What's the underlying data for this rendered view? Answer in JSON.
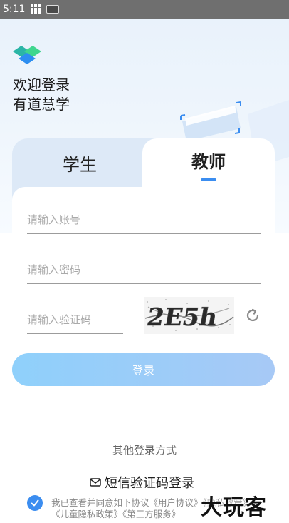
{
  "status_bar": {
    "time": "5:11"
  },
  "welcome": {
    "line1": "欢迎登录",
    "line2": "有道慧学"
  },
  "tabs": [
    {
      "label": "学生",
      "active": false
    },
    {
      "label": "教师",
      "active": true
    }
  ],
  "form": {
    "account_placeholder": "请输入账号",
    "password_placeholder": "请输入密码",
    "captcha_placeholder": "请输入验证码",
    "captcha_text": "2E5h"
  },
  "login_button": "登录",
  "other_login": "其他登录方式",
  "sms_login": "短信验证码登录",
  "agreement": "我已查看并同意如下协议《用户协议》《隐私政策》《儿童隐私政策》《第三方服务》",
  "watermark": "大玩客",
  "colors": {
    "accent": "#3b8df0",
    "button": "#9dcdf8"
  }
}
